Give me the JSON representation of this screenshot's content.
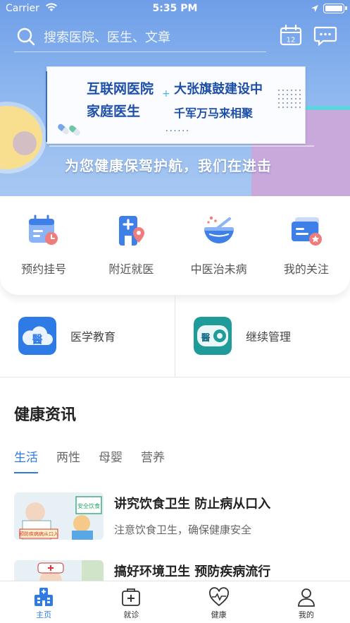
{
  "status_bar": {
    "carrier": "Carrier",
    "time": "5:35 PM"
  },
  "search": {
    "placeholder": "搜索医院、医生、文章",
    "calendar_day": "12"
  },
  "banner": {
    "line1_left": "互联网医院",
    "line1_right": "大张旗鼓建设中",
    "line2_left": "家庭医生",
    "line2_right": "千军万马来相聚",
    "dots": "......",
    "slogan": "为您健康保驾护航，我们在进击"
  },
  "quick_actions": [
    {
      "label": "预约挂号",
      "icon": "calendar-clock-icon"
    },
    {
      "label": "附近就医",
      "icon": "hospital-location-icon"
    },
    {
      "label": "中医治未病",
      "icon": "herbal-bowl-icon"
    },
    {
      "label": "我的关注",
      "icon": "id-card-star-icon"
    }
  ],
  "education": [
    {
      "label": "医学教育",
      "icon": "cloud-medicine-icon",
      "glyph": "醫"
    },
    {
      "label": "继续管理",
      "icon": "medicine-gear-icon",
      "glyph": "醫"
    }
  ],
  "news": {
    "title": "健康资讯",
    "tabs": [
      "生活",
      "两性",
      "母婴",
      "营养"
    ],
    "active_tab": "生活",
    "articles": [
      {
        "title": "讲究饮食卫生  防止病从口入",
        "subtitle": "注意饮食卫生，确保健康安全",
        "thumb_sign": "安全饮食",
        "thumb_banner": "预防疾病病从口入"
      },
      {
        "title": "搞好环境卫生  预防疾病流行",
        "subtitle": ""
      }
    ]
  },
  "tabbar": [
    {
      "label": "主页",
      "icon": "hospital-icon",
      "active": true
    },
    {
      "label": "就诊",
      "icon": "medical-kit-icon",
      "active": false
    },
    {
      "label": "健康",
      "icon": "heart-pulse-icon",
      "active": false
    },
    {
      "label": "我的",
      "icon": "user-icon",
      "active": false
    }
  ],
  "colors": {
    "accent": "#2f7be6",
    "banner_text": "#1d4fa8"
  }
}
